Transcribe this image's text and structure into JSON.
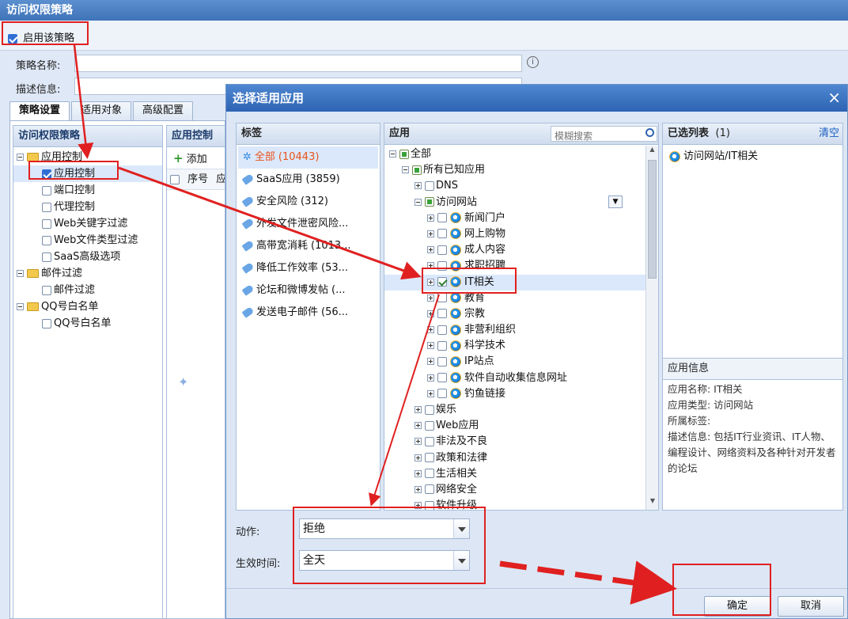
{
  "window": {
    "title": "访问权限策略"
  },
  "toolbar": {
    "enable_label": "启用该策略"
  },
  "form": {
    "name_label": "策略名称:",
    "desc_label": "描述信息:"
  },
  "tabs": [
    "策略设置",
    "适用对象",
    "高级配置"
  ],
  "left_tree": {
    "header": "访问权限策略",
    "items": [
      {
        "label": "应用控制",
        "level": 0,
        "type": "folder"
      },
      {
        "label": "应用控制",
        "level": 1,
        "checked": true
      },
      {
        "label": "端口控制",
        "level": 1
      },
      {
        "label": "代理控制",
        "level": 1
      },
      {
        "label": "Web关键字过滤",
        "level": 1
      },
      {
        "label": "Web文件类型过滤",
        "level": 1
      },
      {
        "label": "SaaS高级选项",
        "level": 1
      },
      {
        "label": "邮件过滤",
        "level": 0,
        "type": "folder"
      },
      {
        "label": "邮件过滤",
        "level": 1
      },
      {
        "label": "QQ号白名单",
        "level": 0,
        "type": "folder"
      },
      {
        "label": "QQ号白名单",
        "level": 1
      }
    ]
  },
  "app_control": {
    "header": "应用控制",
    "add_label": "添加",
    "col_index": "序号",
    "col_more": "应"
  },
  "dialog": {
    "title": "选择适用应用",
    "close": "×",
    "tags": {
      "header": "标签",
      "items": [
        {
          "label": "全部",
          "count": "(10443)",
          "selected": true
        },
        {
          "label": "SaaS应用",
          "count": "(3859)"
        },
        {
          "label": "安全风险",
          "count": "(312)"
        },
        {
          "label": "外发文件泄密风险...",
          "count": ""
        },
        {
          "label": "高带宽消耗",
          "count": "(1013..."
        },
        {
          "label": "降低工作效率",
          "count": "(53..."
        },
        {
          "label": "论坛和微博发帖",
          "count": "(..."
        },
        {
          "label": "发送电子邮件",
          "count": "(56..."
        }
      ]
    },
    "apps": {
      "header": "应用",
      "search_placeholder": "模糊搜索",
      "tree": [
        {
          "label": "全部",
          "level": 0,
          "check": "partial"
        },
        {
          "label": "所有已知应用",
          "level": 1,
          "check": "partial"
        },
        {
          "label": "DNS",
          "level": 2,
          "check": "none"
        },
        {
          "label": "访问网站",
          "level": 2,
          "check": "partial"
        },
        {
          "label": "新闻门户",
          "level": 3,
          "check": "none",
          "icon": "ie"
        },
        {
          "label": "网上购物",
          "level": 3,
          "check": "none",
          "icon": "ie"
        },
        {
          "label": "成人内容",
          "level": 3,
          "check": "none",
          "icon": "ie"
        },
        {
          "label": "求职招聘",
          "level": 3,
          "check": "none",
          "icon": "ie"
        },
        {
          "label": "IT相关",
          "level": 3,
          "check": "checked",
          "icon": "ie"
        },
        {
          "label": "教育",
          "level": 3,
          "check": "none",
          "icon": "ie"
        },
        {
          "label": "宗教",
          "level": 3,
          "check": "none",
          "icon": "ie"
        },
        {
          "label": "非营利组织",
          "level": 3,
          "check": "none",
          "icon": "ie"
        },
        {
          "label": "科学技术",
          "level": 3,
          "check": "none",
          "icon": "ie"
        },
        {
          "label": "IP站点",
          "level": 3,
          "check": "none",
          "icon": "ie"
        },
        {
          "label": "软件自动收集信息网址",
          "level": 3,
          "check": "none",
          "icon": "ie"
        },
        {
          "label": "钓鱼链接",
          "level": 3,
          "check": "none",
          "icon": "ie"
        },
        {
          "label": "娱乐",
          "level": 2,
          "check": "none"
        },
        {
          "label": "Web应用",
          "level": 2,
          "check": "none"
        },
        {
          "label": "非法及不良",
          "level": 2,
          "check": "none"
        },
        {
          "label": "政策和法律",
          "level": 2,
          "check": "none"
        },
        {
          "label": "生活相关",
          "level": 2,
          "check": "none"
        },
        {
          "label": "网络安全",
          "level": 2,
          "check": "none"
        },
        {
          "label": "软件升级",
          "level": 2,
          "check": "none"
        }
      ]
    },
    "selected": {
      "header": "已选列表",
      "count": "(1)",
      "clear_label": "清空",
      "items": [
        "访问网站/IT相关"
      ]
    },
    "app_info": {
      "header": "应用信息",
      "name": "应用名称: IT相关",
      "type": "应用类型: 访问网站",
      "tags": "所属标签:",
      "desc": "描述信息: 包括IT行业资讯、IT人物、编程设计、网络资料及各种针对开发者的论坛"
    },
    "action": {
      "label": "动作:",
      "value": "拒绝"
    },
    "time": {
      "label": "生效时间:",
      "value": "全天"
    },
    "ok_label": "确定",
    "cancel_label": "取消"
  },
  "colors": {
    "accent": "#2e64b3",
    "annotation": "#e02020",
    "tag_selected": "#e8541c"
  }
}
